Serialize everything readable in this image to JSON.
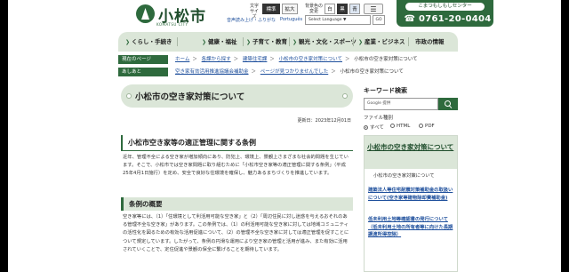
{
  "header": {
    "logo_text": "小松市",
    "logo_sub": "KOMATSU CITY",
    "font_size_label": "文字\nサイズ",
    "font_standard": "標準",
    "font_large": "拡大",
    "bg_color_label": "背景色の\n変更",
    "bg_white": "白",
    "bg_black": "黒",
    "bg_blue": "青",
    "furigana_link": "音声読み上げ・ふりがな",
    "portuguese_link": "Português",
    "lang_select": "Select Language ▼",
    "lang_go": "GO",
    "call_center_label": "こまつもしもしセンター",
    "call_center_tel": "☎ 0761-20-0404"
  },
  "nav": [
    {
      "label": "くらし・手続き"
    },
    {
      "label": "健康・福祉"
    },
    {
      "label": "子育て・教育"
    },
    {
      "label": "観光・文化・スポーツ"
    },
    {
      "label": "産業・ビジネス"
    },
    {
      "label": "市政の情報"
    }
  ],
  "breadcrumb": {
    "current_tag": "現在のページ",
    "items": [
      "ホーム",
      "各課から探す",
      "建築住宅課",
      "小松市の空き家対策について"
    ],
    "current": "小松市の空き家対策について",
    "history_tag": "あしあと",
    "history": [
      "空き家有効活用推進協議会補助金",
      "ページが見つかりませんでした"
    ],
    "history_current": "小松市の空き家対策について"
  },
  "main": {
    "title": "小松市の空き家対策について",
    "updated": "更新日：2023年12月01日",
    "section1_title": "小松市空き家等の適正管理に関する条例",
    "section1_body": "近年、管理不全による空き家が増加傾向にあり、防犯上、環境上、景観上さまざまな社会的問題を生じています。そこで、小松市では空き家問題に取り組むために「小松市空き家等の適正管理に関する条例」（平成25年4月1日施行）を定め、安全で良好な住環境を確保し、魅力あるまちづくりを推進しています。",
    "section2_title": "条例の概要",
    "section2_body": "空き家等には、（1）「住環境として利活用可能な空き家」と（2）「周辺住民に対し迷惑を与えるおそれのある管理不全な空き家」があります。この条例では、（1）の利活用可能な空き家に対しては地域コミュニティの活性化を図るための有効な活用促進について、（2）の管理不全な空き家に対しては適正管理を促すことについて規定しています。したがって、条例の円滑な運用により空き家の管理と活用が進み、また有効に活用されていくことで、定住促進や景観の保全に繋げることを期待しています。"
  },
  "side": {
    "keyword_title": "キーワード検索",
    "search_placeholder": "Google 提供",
    "filetype_title": "ファイル種別",
    "filetype_options": [
      "すべて",
      "HTML",
      "PDF"
    ],
    "related_title": "小松市の空き家対策について",
    "related_items": [
      "小松市の空き家対策について",
      "建築法人等住宅耐震対策補助金の取扱いについて(空き家等建物除却費補助金)",
      "低未利用土地等確認書の発行について（低未利用土地の所有者等に向けた長期譲渡所得控除）"
    ]
  },
  "colors": {
    "brand_green": "#2e6a3d",
    "light_green": "#dbe6d8",
    "link_blue": "#1e4f9c"
  }
}
